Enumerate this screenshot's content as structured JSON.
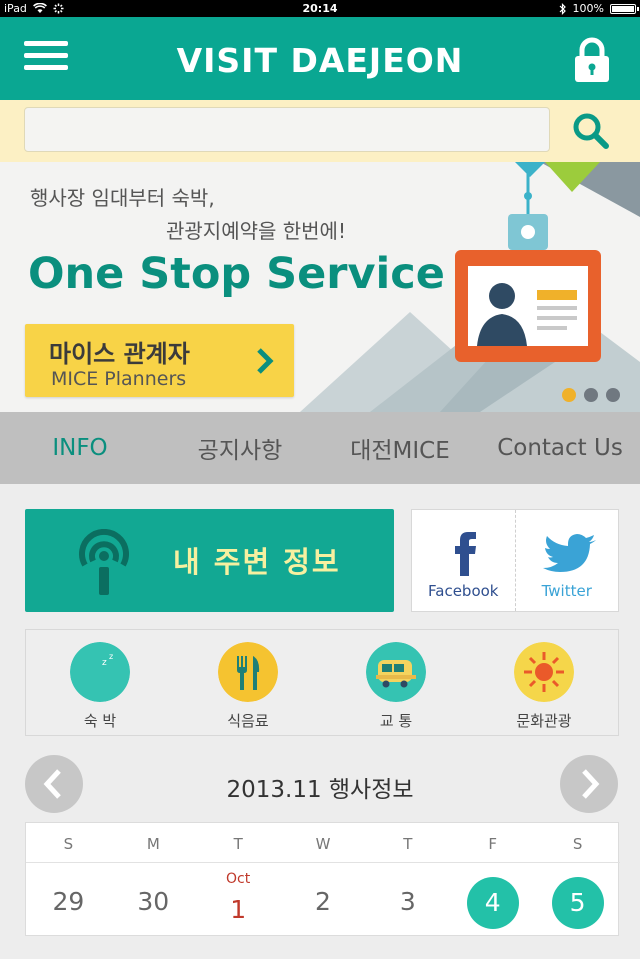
{
  "status_bar": {
    "device": "iPad",
    "time": "20:14",
    "battery": "100%"
  },
  "header": {
    "title": "VISIT DAEJEON"
  },
  "search": {
    "placeholder": "",
    "value": ""
  },
  "banner": {
    "line1": "행사장 임대부터 숙박,",
    "line2": "관광지예약을 한번에!",
    "headline": "One Stop Service",
    "cta_ko": "마이스 관계자",
    "cta_en": "MICE Planners",
    "dot_count": 3,
    "active_dot": 0
  },
  "tabs": [
    {
      "label": "INFO",
      "active": true
    },
    {
      "label": "공지사항",
      "active": false
    },
    {
      "label": "대전MICE",
      "active": false
    },
    {
      "label": "Contact  Us",
      "active": false
    }
  ],
  "my_area": {
    "label": "내 주변 정보"
  },
  "social": {
    "facebook": "Facebook",
    "twitter": "Twitter"
  },
  "categories": [
    {
      "label": "숙 박",
      "icon": "moon-sleep-icon",
      "color": "#35c3b2"
    },
    {
      "label": "식음료",
      "icon": "fork-knife-icon",
      "color": "#f5c330"
    },
    {
      "label": "교 통",
      "icon": "bus-icon",
      "color": "#35c3b2"
    },
    {
      "label": "문화관광",
      "icon": "sun-icon",
      "color": "#f5d64a"
    }
  ],
  "calendar": {
    "title": "2013.11 행사정보",
    "days": [
      "S",
      "M",
      "T",
      "W",
      "T",
      "F",
      "S"
    ],
    "dates": [
      {
        "num": "29"
      },
      {
        "num": "30"
      },
      {
        "num": "1",
        "month": "Oct",
        "red": true
      },
      {
        "num": "2"
      },
      {
        "num": "3"
      },
      {
        "num": "4",
        "highlight": true
      },
      {
        "num": "5",
        "highlight": true
      }
    ]
  },
  "colors": {
    "primary": "#0aa792",
    "accent_yellow": "#f8d347",
    "search_bg": "#fcf0c4"
  }
}
